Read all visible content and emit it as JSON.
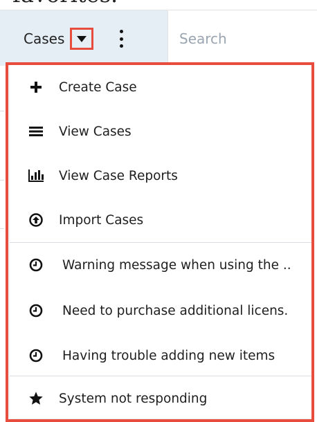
{
  "heading": {
    "text": "favorites."
  },
  "nav": {
    "module_label": "Cases",
    "search_placeholder": "Search",
    "colors": {
      "nav_bg": "#e6eef5",
      "highlight": "#e74c3c"
    }
  },
  "menu": {
    "actions": [
      {
        "label": "Create Case",
        "icon": "plus-icon"
      },
      {
        "label": "View Cases",
        "icon": "list-icon"
      },
      {
        "label": "View Case Reports",
        "icon": "bar-chart-icon"
      },
      {
        "label": "Import Cases",
        "icon": "upload-circle-icon"
      }
    ],
    "recent": [
      {
        "label": "Warning message when using the ..",
        "icon": "clock-icon"
      },
      {
        "label": "Need to purchase additional licens.",
        "icon": "clock-icon"
      },
      {
        "label": "Having trouble adding new items",
        "icon": "clock-icon"
      }
    ],
    "favorites": [
      {
        "label": "System not responding",
        "icon": "star-icon"
      }
    ]
  }
}
